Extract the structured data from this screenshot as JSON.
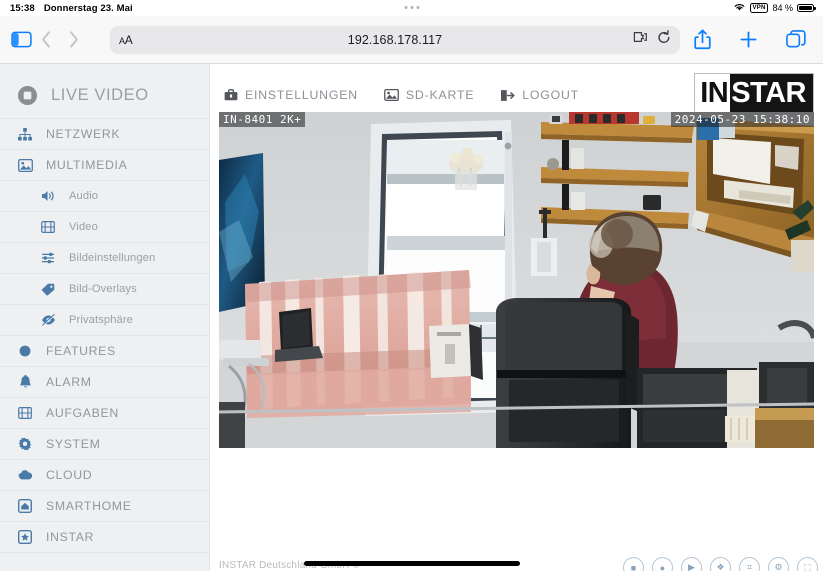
{
  "status_bar": {
    "time": "15:38",
    "date": "Donnerstag 23. Mai",
    "vpn_label": "VPN",
    "battery_pct": "84 %",
    "wifi_icon": "wifi-icon",
    "battery_icon": "battery-icon",
    "dots_icon": "multitasking-dots-icon"
  },
  "browser": {
    "sidebar_toggle_icon": "sidebar-toggle-icon",
    "back_icon": "chevron-left-icon",
    "forward_icon": "chevron-right-icon",
    "text_size_label": "AA",
    "url": "192.168.178.117",
    "extensions_icon": "puzzle-extension-icon",
    "reload_icon": "reload-icon",
    "share_icon": "share-icon",
    "new_tab_icon": "plus-icon",
    "tabs_icon": "tabs-overview-icon"
  },
  "sidebar": {
    "brand": {
      "label": "LIVE VIDEO",
      "icon": "record-circle-icon"
    },
    "items": [
      {
        "label": "NETZWERK",
        "icon": "sitemap-icon",
        "level": "top"
      },
      {
        "label": "MULTIMEDIA",
        "icon": "image-icon",
        "level": "top"
      },
      {
        "label": "Audio",
        "icon": "speaker-icon",
        "level": "sub"
      },
      {
        "label": "Video",
        "icon": "film-icon",
        "level": "sub"
      },
      {
        "label": "Bildeinstellungen",
        "icon": "sliders-icon",
        "level": "sub"
      },
      {
        "label": "Bild-Overlays",
        "icon": "tag-icon",
        "level": "sub"
      },
      {
        "label": "Privatsphäre",
        "icon": "eye-slash-icon",
        "level": "sub"
      },
      {
        "label": "FEATURES",
        "icon": "circle-icon",
        "level": "top"
      },
      {
        "label": "ALARM",
        "icon": "bell-icon",
        "level": "top"
      },
      {
        "label": "AUFGABEN",
        "icon": "film-icon",
        "level": "top"
      },
      {
        "label": "SYSTEM",
        "icon": "gear-icon",
        "level": "top"
      },
      {
        "label": "CLOUD",
        "icon": "cloud-icon",
        "level": "top"
      },
      {
        "label": "SMARTHOME",
        "icon": "home-box-icon",
        "level": "top"
      },
      {
        "label": "INSTAR",
        "icon": "star-box-icon",
        "level": "top"
      }
    ]
  },
  "topnav": {
    "links": [
      {
        "label": "EINSTELLUNGEN",
        "icon": "toolbox-icon"
      },
      {
        "label": "SD-KARTE",
        "icon": "sdcard-image-icon"
      },
      {
        "label": "LOGOUT",
        "icon": "logout-icon"
      }
    ],
    "logo": {
      "part1": "IN",
      "part2": "STAR"
    }
  },
  "video": {
    "osd_model": "IN-8401 2K+",
    "osd_timestamp": "2024-05-23 15:38:10"
  },
  "footer": {
    "copyright": "INSTAR Deutschland GmbH ©",
    "control_buttons": [
      "■",
      "●",
      "▶",
      "❖",
      "⌗",
      "⚙",
      "⬚"
    ]
  },
  "colors": {
    "sidebar_bg": "#eff0f2",
    "icon_blue": "#4a7ba8",
    "text_gray": "#92979d",
    "safari_blue": "#0a7cff",
    "url_bg": "#e8e8ea"
  }
}
